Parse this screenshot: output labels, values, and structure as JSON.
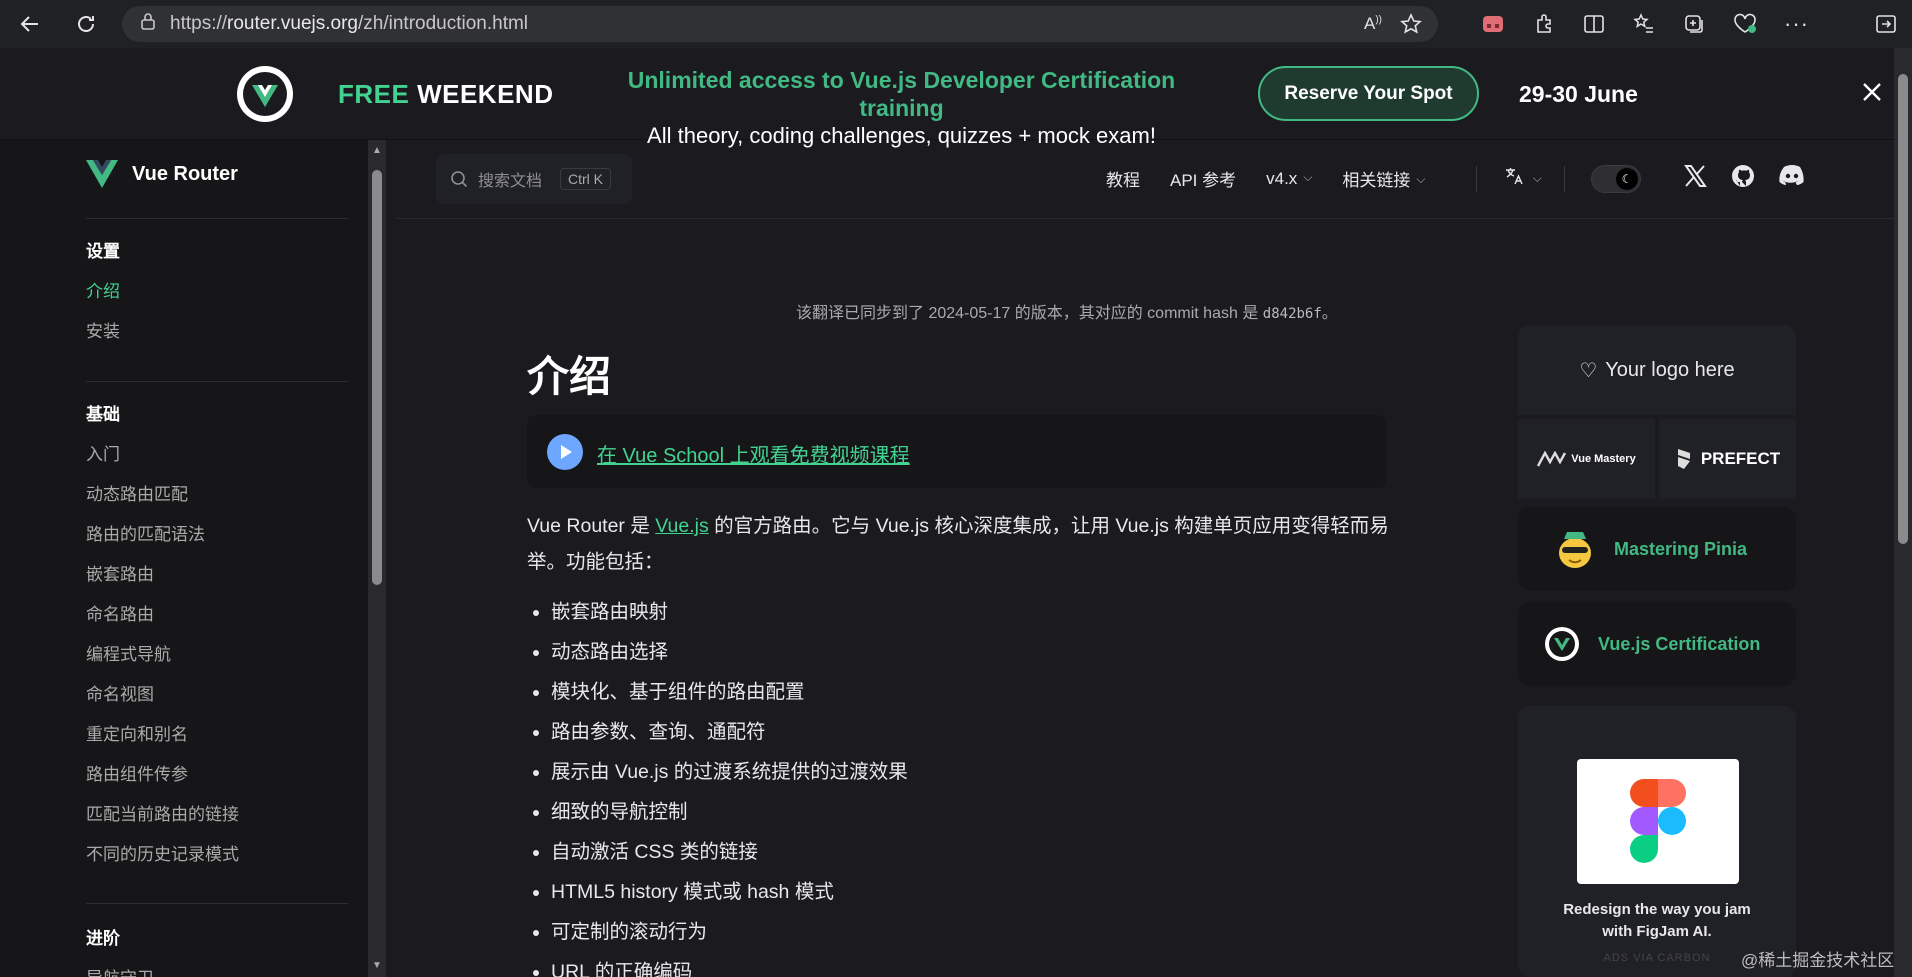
{
  "browser": {
    "url_prefix": "https://",
    "url_host": "router.vuejs.org",
    "url_path": "/zh/introduction.html"
  },
  "banner": {
    "free": "FREE",
    "weekend": "WEEKEND",
    "line1": "Unlimited access to Vue.js Developer Certification training",
    "line2": "All theory, coding challenges, quizzes + mock exam!",
    "cta": "Reserve Your Spot",
    "dates": "29-30 June"
  },
  "sidebar": {
    "brand": "Vue Router",
    "groups": [
      {
        "title": "设置",
        "items": [
          "介绍",
          "安装"
        ]
      },
      {
        "title": "基础",
        "items": [
          "入门",
          "动态路由匹配",
          "路由的匹配语法",
          "嵌套路由",
          "命名路由",
          "编程式导航",
          "命名视图",
          "重定向和别名",
          "路由组件传参",
          "匹配当前路由的链接",
          "不同的历史记录模式"
        ]
      },
      {
        "title": "进阶",
        "items": [
          "导航守卫"
        ]
      }
    ],
    "active_item": "介绍"
  },
  "nav": {
    "search_placeholder": "搜索文档",
    "search_kbd": "Ctrl K",
    "links": [
      "教程",
      "API 参考",
      "v4.x",
      "相关链接"
    ]
  },
  "content": {
    "notice_text": "该翻译已同步到了 2024-05-17 的版本，其对应的 commit hash 是",
    "notice_hash": "d842b6f",
    "notice_end": "。",
    "title": "介绍",
    "video_link": "在 Vue School 上观看免费视频课程",
    "intro_pre": "Vue Router 是 ",
    "intro_link": "Vue.js",
    "intro_post": " 的官方路由。它与 Vue.js 核心深度集成，让用 Vue.js 构建单页应用变得轻而易举。功能包括：",
    "features": [
      "嵌套路由映射",
      "动态路由选择",
      "模块化、基于组件的路由配置",
      "路由参数、查询、通配符",
      "展示由 Vue.js 的过渡系统提供的过渡效果",
      "细致的导航控制",
      "自动激活 CSS 类的链接",
      "HTML5 history 模式或 hash 模式",
      "可定制的滚动行为",
      "URL 的正确编码"
    ]
  },
  "aside": {
    "logo_placeholder": "Your logo here",
    "sponsor1": "Vue Mastery",
    "sponsor2": "PREFECT",
    "card1": "Mastering Pinia",
    "card2": "Vue.js Certification",
    "ad_text_l1": "Redesign the way you jam",
    "ad_text_l2": "with FigJam AI.",
    "ad_cb": "ADS VIA CARBON"
  },
  "watermark": "@稀土掘金技术社区",
  "colors": {
    "accent": "#42d392",
    "bg": "#1b1b1f",
    "sidebar": "#161618"
  }
}
